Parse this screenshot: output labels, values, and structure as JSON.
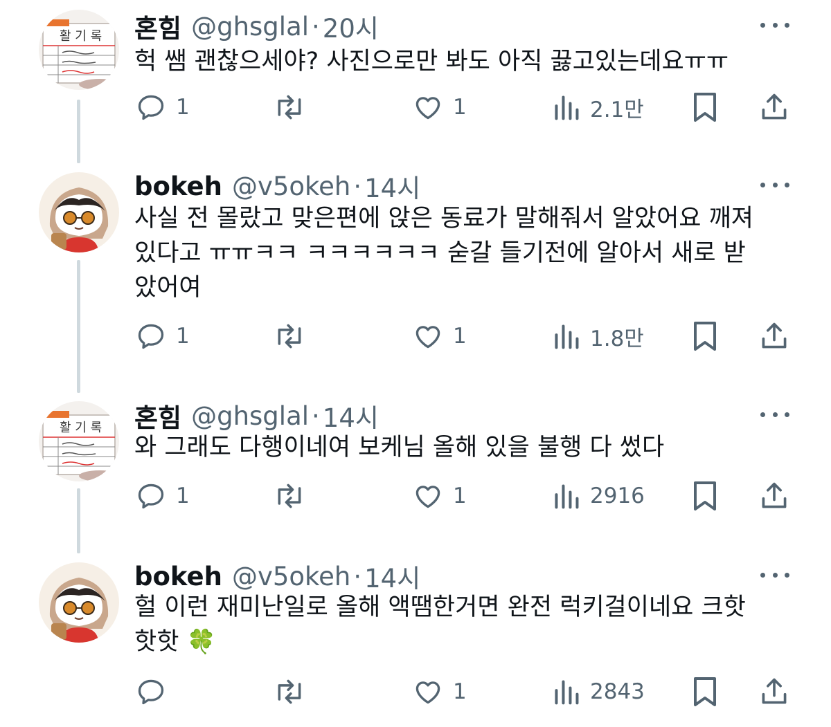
{
  "tweets": [
    {
      "name": "혼힘",
      "handle": "@ghsglal",
      "time": "20시",
      "avatar": "avatar-honhim",
      "lines": [
        "헉 쌤 괜찮으세야? 사진으로만 봐도 아직 끓고있는데요ㅠㅠ"
      ],
      "replies": "1",
      "reposts": "",
      "likes": "1",
      "views": "2.1만"
    },
    {
      "name": "bokeh",
      "handle": "@v5okeh",
      "time": "14시",
      "avatar": "avatar-bokeh",
      "lines": [
        "사실 전 몰랐고 맞은편에 앉은 동료가 말해줘서 알았어요 깨져",
        "있다고 ㅠㅠㅋㅋ ㅋㅋㅋㅋㅋㅋ 숟갈 들기전에 알아서 새로 받",
        "았어여"
      ],
      "replies": "1",
      "reposts": "",
      "likes": "1",
      "views": "1.8만"
    },
    {
      "name": "혼힘",
      "handle": "@ghsglal",
      "time": "14시",
      "avatar": "avatar-honhim",
      "lines": [
        "와 그래도 다행이네여 보케님 올해 있을 불행 다 썼다"
      ],
      "replies": "1",
      "reposts": "",
      "likes": "1",
      "views": "2916"
    },
    {
      "name": "bokeh",
      "handle": "@v5okeh",
      "time": "14시",
      "avatar": "avatar-bokeh",
      "lines": [
        "헐 이런 재미난일로 올해 액땜한거면 완전 럭키걸이네요 크핫",
        "핫핫"
      ],
      "emoji": "🍀",
      "replies": "",
      "reposts": "",
      "likes": "1",
      "views": "2843"
    }
  ],
  "dot": "·",
  "icons": {
    "reply": "reply-icon",
    "repost": "repost-icon",
    "like": "heart-icon",
    "views": "views-icon",
    "bookmark": "bookmark-icon",
    "share": "share-icon",
    "more": "more-icon"
  },
  "colors": {
    "text": "#0f1419",
    "secondary": "#536471",
    "thread_line": "#cfd9de"
  }
}
